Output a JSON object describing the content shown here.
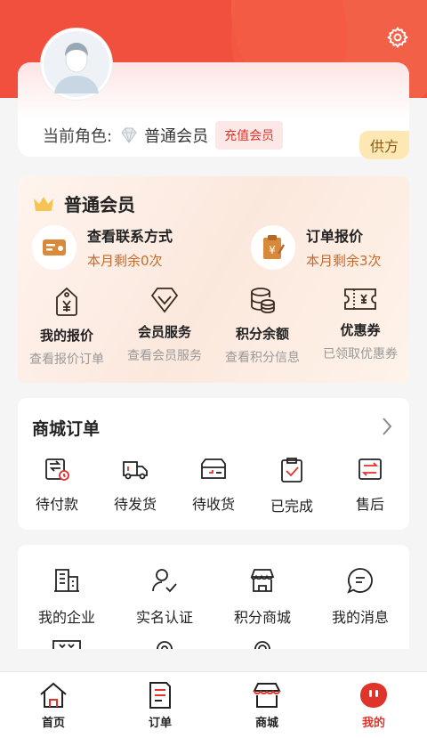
{
  "profile": {
    "role_label": "当前角色:",
    "role_name": "普通会员",
    "recharge_label": "充值会员",
    "supplier_label": "供方"
  },
  "member": {
    "title": "普通会员",
    "features": [
      {
        "title": "查看联系方式",
        "subtitle": "本月剩余0次",
        "icon": "contact-card-icon"
      },
      {
        "title": "订单报价",
        "subtitle": "本月剩余3次",
        "icon": "order-quote-icon"
      }
    ],
    "items": [
      {
        "title": "我的报价",
        "subtitle": "查看报价订单",
        "icon": "price-tag-icon"
      },
      {
        "title": "会员服务",
        "subtitle": "查看会员服务",
        "icon": "diamond-icon"
      },
      {
        "title": "积分余额",
        "subtitle": "查看积分信息",
        "icon": "coins-icon"
      },
      {
        "title": "优惠券",
        "subtitle": "已领取优惠券",
        "icon": "coupon-icon"
      }
    ]
  },
  "orders": {
    "title": "商城订单",
    "items": [
      {
        "label": "待付款",
        "icon": "wallet-icon"
      },
      {
        "label": "待发货",
        "icon": "truck-icon"
      },
      {
        "label": "待收货",
        "icon": "package-icon"
      },
      {
        "label": "已完成",
        "icon": "clipboard-check-icon"
      },
      {
        "label": "售后",
        "icon": "exchange-icon"
      }
    ]
  },
  "services": {
    "items": [
      {
        "label": "我的企业",
        "icon": "building-icon"
      },
      {
        "label": "实名认证",
        "icon": "user-verify-icon"
      },
      {
        "label": "积分商城",
        "icon": "store-icon"
      },
      {
        "label": "我的消息",
        "icon": "message-icon"
      }
    ]
  },
  "tabbar": {
    "items": [
      {
        "label": "首页",
        "icon": "home-icon"
      },
      {
        "label": "订单",
        "icon": "order-icon"
      },
      {
        "label": "商城",
        "icon": "shop-icon"
      },
      {
        "label": "我的",
        "icon": "profile-icon"
      }
    ],
    "active": "我的"
  },
  "colors": {
    "brand_red": "#f2503f",
    "accent_red": "#e0332a",
    "gold": "#c46b2c"
  }
}
